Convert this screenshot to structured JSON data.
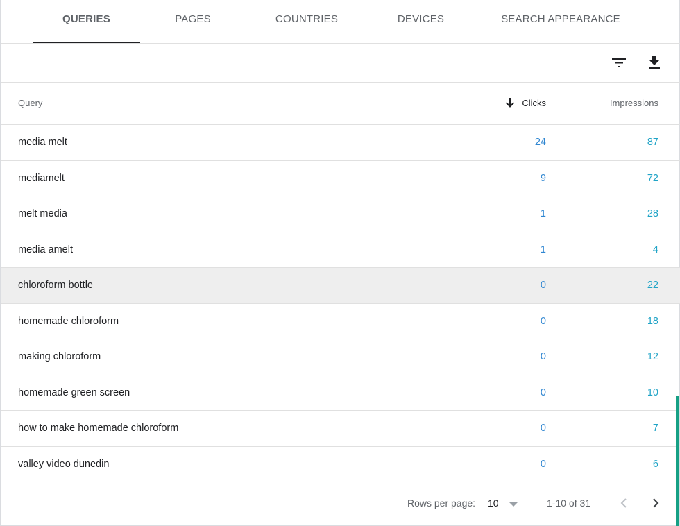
{
  "tabs": [
    {
      "label": "QUERIES",
      "active": true
    },
    {
      "label": "PAGES",
      "active": false
    },
    {
      "label": "COUNTRIES",
      "active": false
    },
    {
      "label": "DEVICES",
      "active": false
    },
    {
      "label": "SEARCH APPEARANCE",
      "active": false
    }
  ],
  "toolbar": {
    "filter_icon": "filter-list-icon",
    "download_icon": "download-icon"
  },
  "table": {
    "headers": {
      "query": "Query",
      "clicks": "Clicks",
      "impressions": "Impressions"
    },
    "sort_icon": "arrow-down-icon",
    "rows": [
      {
        "query": "media melt",
        "clicks": "24",
        "impressions": "87"
      },
      {
        "query": "mediamelt",
        "clicks": "9",
        "impressions": "72"
      },
      {
        "query": "melt media",
        "clicks": "1",
        "impressions": "28"
      },
      {
        "query": "media amelt",
        "clicks": "1",
        "impressions": "4"
      },
      {
        "query": "chloroform bottle",
        "clicks": "0",
        "impressions": "22"
      },
      {
        "query": "homemade chloroform",
        "clicks": "0",
        "impressions": "18"
      },
      {
        "query": "making chloroform",
        "clicks": "0",
        "impressions": "12"
      },
      {
        "query": "homemade green screen",
        "clicks": "0",
        "impressions": "10"
      },
      {
        "query": "how to make homemade chloroform",
        "clicks": "0",
        "impressions": "7"
      },
      {
        "query": "valley video dunedin",
        "clicks": "0",
        "impressions": "6"
      }
    ]
  },
  "pagination": {
    "rows_per_page_label": "Rows per page:",
    "rows_per_page_value": "10",
    "range": "1-10 of 31"
  },
  "colors": {
    "clicks": "#2f86d1",
    "impressions": "#20a4c7",
    "scroll_accent": "#16a085"
  }
}
